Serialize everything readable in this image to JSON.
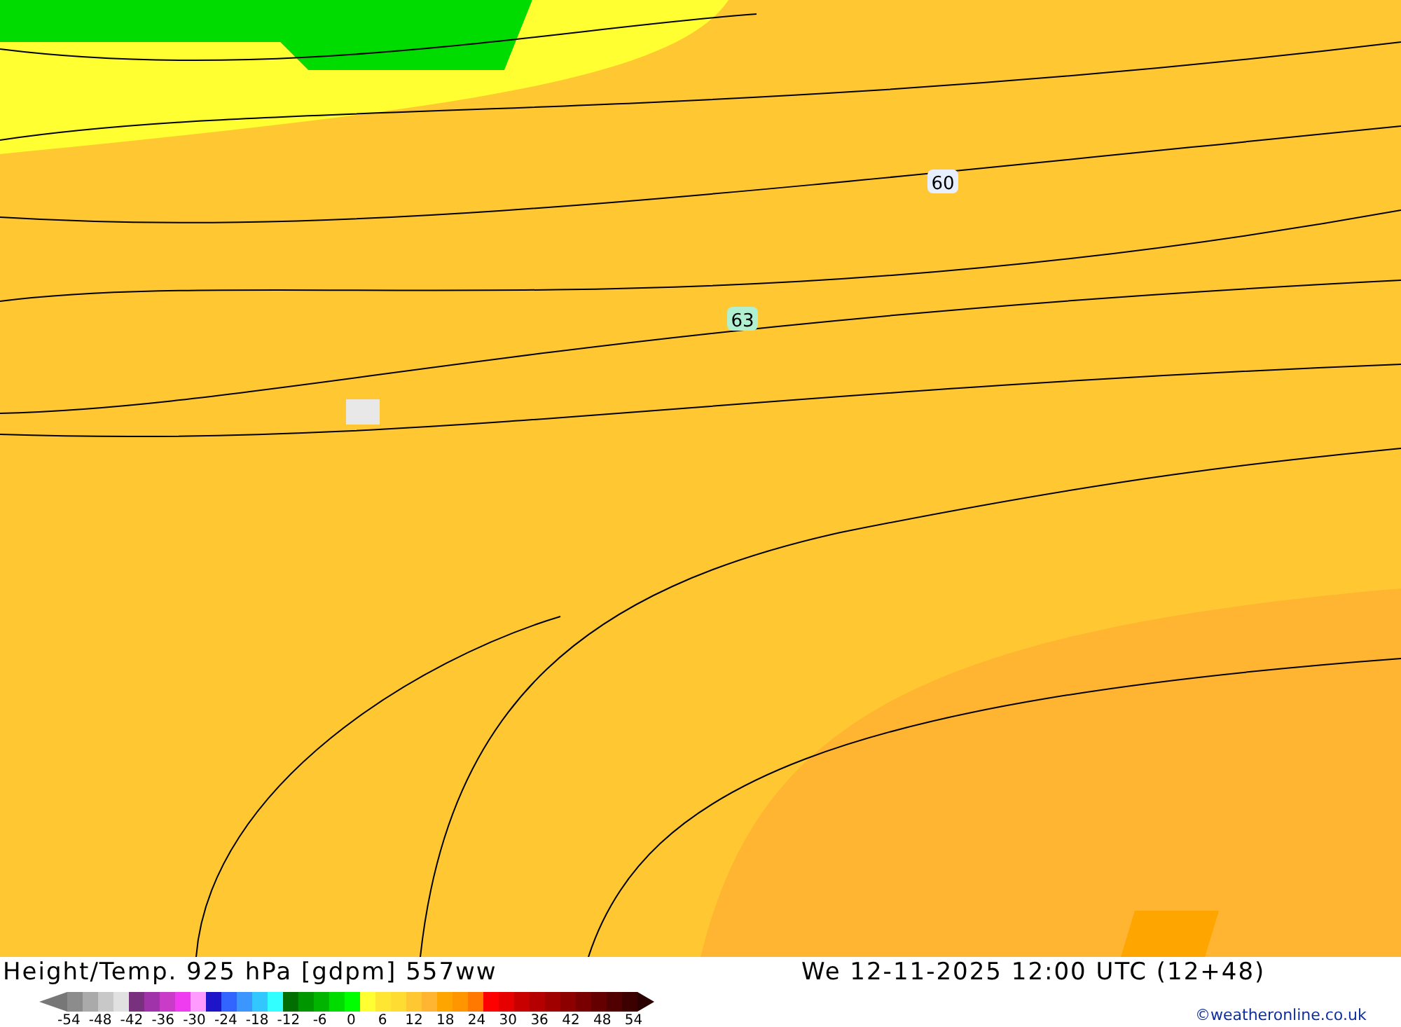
{
  "map": {
    "contour_labels": [
      "60",
      "63"
    ]
  },
  "title": "Height/Temp. 925 hPa [gdpm] 557ww",
  "valid_time": "We 12-11-2025 12:00 UTC (12+48)",
  "legend": {
    "swatches": [
      {
        "color": "#8c8c8c"
      },
      {
        "color": "#aaaaaa"
      },
      {
        "color": "#c8c8c8"
      },
      {
        "color": "#e1e1e1"
      },
      {
        "color": "#78327d"
      },
      {
        "color": "#a032aa"
      },
      {
        "color": "#c83cc8"
      },
      {
        "color": "#f03cf0"
      },
      {
        "color": "#ff9bff"
      },
      {
        "color": "#1e14c8"
      },
      {
        "color": "#3264ff"
      },
      {
        "color": "#3c96ff"
      },
      {
        "color": "#32c8ff"
      },
      {
        "color": "#32ffff"
      },
      {
        "color": "#006e00"
      },
      {
        "color": "#009600"
      },
      {
        "color": "#00b400"
      },
      {
        "color": "#00dc00"
      },
      {
        "color": "#00ff00"
      },
      {
        "color": "#ffff32"
      },
      {
        "color": "#ffe632"
      },
      {
        "color": "#ffdc32"
      },
      {
        "color": "#ffc832"
      },
      {
        "color": "#ffb432"
      },
      {
        "color": "#ffa500"
      },
      {
        "color": "#ff9600"
      },
      {
        "color": "#ff7800"
      },
      {
        "color": "#ff0000"
      },
      {
        "color": "#e60000"
      },
      {
        "color": "#c80000"
      },
      {
        "color": "#b40000"
      },
      {
        "color": "#a00000"
      },
      {
        "color": "#8c0000"
      },
      {
        "color": "#780000"
      },
      {
        "color": "#640000"
      },
      {
        "color": "#500000"
      },
      {
        "color": "#3c0000"
      }
    ],
    "ticks": [
      "-54",
      "-48",
      "-42",
      "-36",
      "-30",
      "-24",
      "-18",
      "-12",
      "-6",
      "0",
      "6",
      "12",
      "18",
      "24",
      "30",
      "36",
      "42",
      "48",
      "54"
    ]
  },
  "credit": "©weatheronline.co.uk"
}
